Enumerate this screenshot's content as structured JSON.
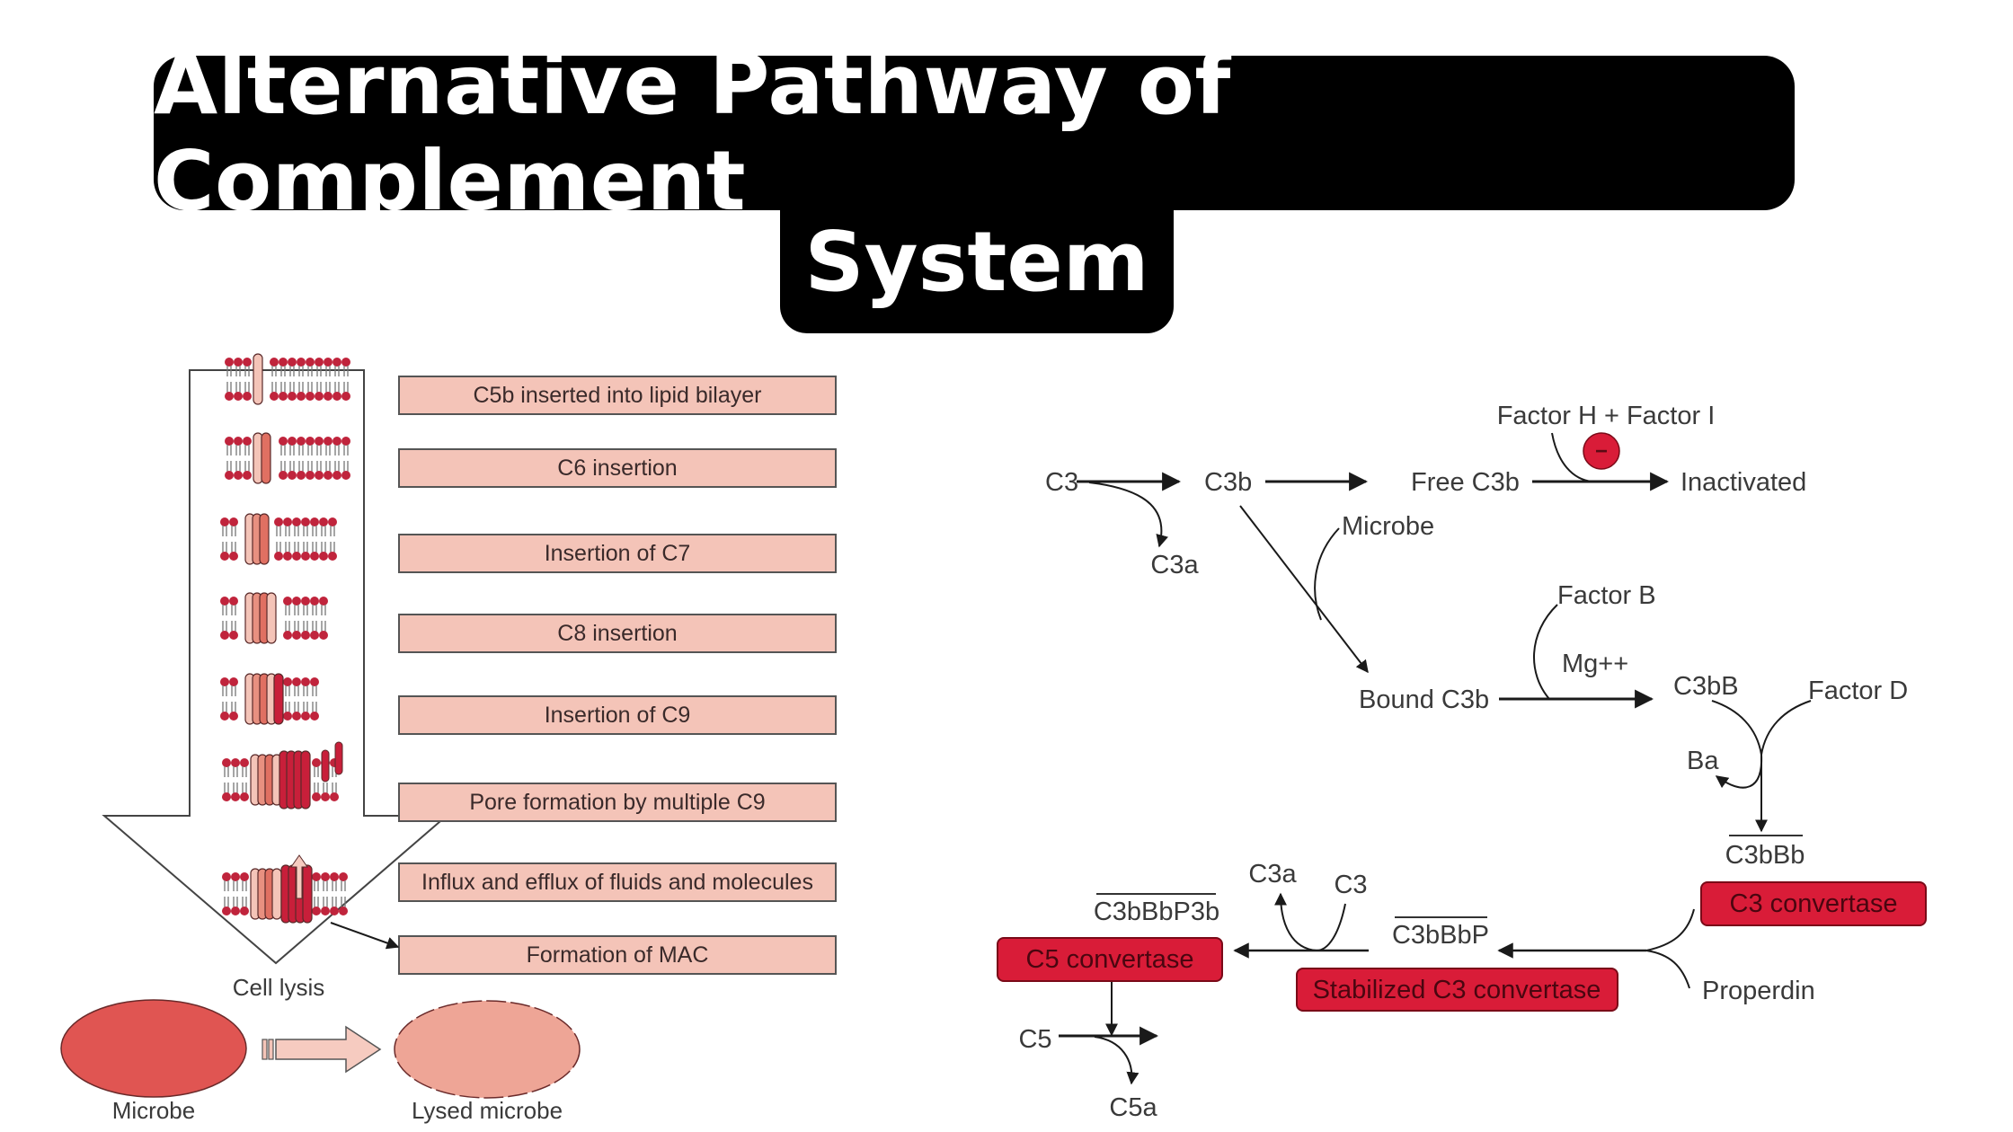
{
  "title": {
    "line1": "Alternative Pathway of Complement",
    "line2": "System"
  },
  "colors": {
    "title_bg": "#000000",
    "title_fg": "#ffffff",
    "step_box_fill": "#f4c4b8",
    "convertase_fill": "#d91c38",
    "inhibitor_fill": "#d91c38",
    "microbe_fill": "#e05552",
    "lysed_fill": "#eea596"
  },
  "mac_panel": {
    "steps": [
      "C5b inserted into lipid bilayer",
      "C6 insertion",
      "Insertion of C7",
      "C8 insertion",
      "Insertion of C9",
      "Pore formation by multiple C9",
      "Influx and efflux of fluids and molecules",
      "Formation of MAC"
    ],
    "outcome_label": "Cell lysis",
    "microbe_label": "Microbe",
    "lysed_label": "Lysed microbe"
  },
  "pathway_panel": {
    "nodes": {
      "c3": "C3",
      "c3b": "C3b",
      "free_c3b": "Free C3b",
      "inactivated": "Inactivated",
      "factor_h_i": "Factor H + Factor I",
      "inhibit_symbol": "−",
      "c3a_top": "C3a",
      "microbe": "Microbe",
      "bound_c3b": "Bound C3b",
      "factor_b": "Factor B",
      "mg": "Mg++",
      "c3bB": "C3bB",
      "factor_d": "Factor D",
      "ba": "Ba",
      "c3bBb": "C3bBb",
      "properdin": "Properdin",
      "c3bBbP": "C3bBbP",
      "c3a_bottom": "C3a",
      "c3_bottom": "C3",
      "c3bBbP3b": "C3bBbP3b",
      "c5": "C5",
      "c5a": "C5a"
    },
    "enzymes": {
      "c3_convertase": "C3 convertase",
      "stabilized_c3_convertase": "Stabilized C3 convertase",
      "c5_convertase": "C5 convertase"
    }
  }
}
